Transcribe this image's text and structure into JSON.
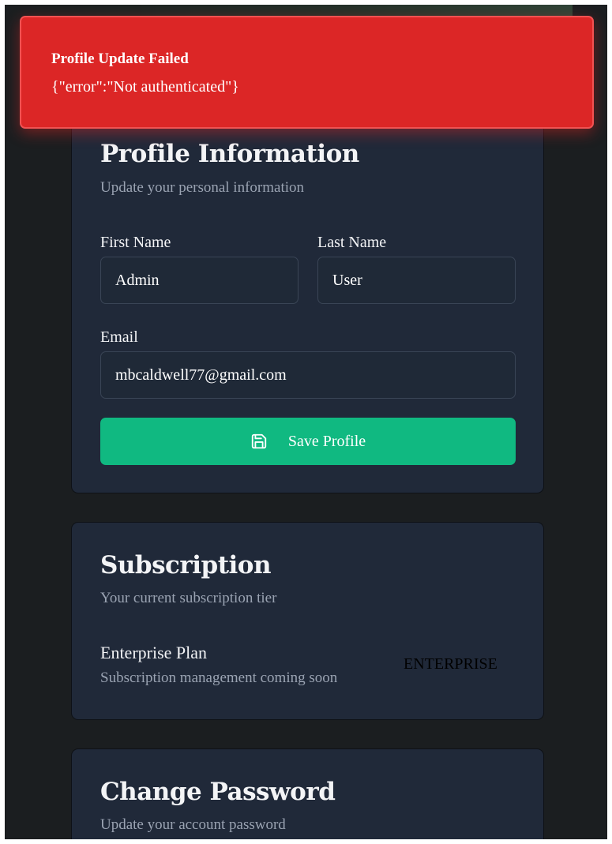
{
  "toast": {
    "title": "Profile Update Failed",
    "message": "{\"error\":\"Not authenticated\"}"
  },
  "profile": {
    "title": "Profile Information",
    "subtitle": "Update your personal information",
    "first_name_label": "First Name",
    "first_name_value": "Admin",
    "last_name_label": "Last Name",
    "last_name_value": "User",
    "email_label": "Email",
    "email_value": "mbcaldwell77@gmail.com",
    "save_label": "Save Profile",
    "save_icon": "save-icon"
  },
  "subscription": {
    "title": "Subscription",
    "subtitle": "Your current subscription tier",
    "plan_name": "Enterprise Plan",
    "plan_note": "Subscription management coming soon",
    "badge": "ENTERPRISE"
  },
  "password": {
    "title": "Change Password",
    "subtitle": "Update your account password"
  },
  "colors": {
    "background": "#1b1e20",
    "card": "#202939",
    "accent": "#10b981",
    "error": "#dc2626"
  }
}
